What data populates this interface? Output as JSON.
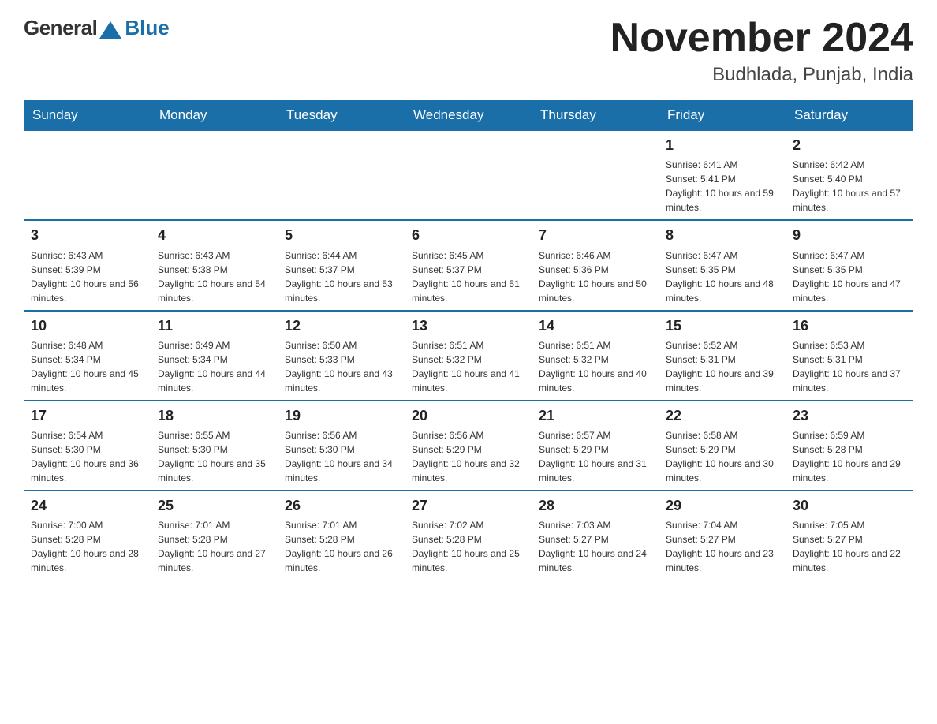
{
  "header": {
    "logo_general": "General",
    "logo_blue": "Blue",
    "month_title": "November 2024",
    "location": "Budhlada, Punjab, India"
  },
  "days_of_week": [
    "Sunday",
    "Monday",
    "Tuesday",
    "Wednesday",
    "Thursday",
    "Friday",
    "Saturday"
  ],
  "weeks": [
    [
      {
        "day": "",
        "info": ""
      },
      {
        "day": "",
        "info": ""
      },
      {
        "day": "",
        "info": ""
      },
      {
        "day": "",
        "info": ""
      },
      {
        "day": "",
        "info": ""
      },
      {
        "day": "1",
        "info": "Sunrise: 6:41 AM\nSunset: 5:41 PM\nDaylight: 10 hours and 59 minutes."
      },
      {
        "day": "2",
        "info": "Sunrise: 6:42 AM\nSunset: 5:40 PM\nDaylight: 10 hours and 57 minutes."
      }
    ],
    [
      {
        "day": "3",
        "info": "Sunrise: 6:43 AM\nSunset: 5:39 PM\nDaylight: 10 hours and 56 minutes."
      },
      {
        "day": "4",
        "info": "Sunrise: 6:43 AM\nSunset: 5:38 PM\nDaylight: 10 hours and 54 minutes."
      },
      {
        "day": "5",
        "info": "Sunrise: 6:44 AM\nSunset: 5:37 PM\nDaylight: 10 hours and 53 minutes."
      },
      {
        "day": "6",
        "info": "Sunrise: 6:45 AM\nSunset: 5:37 PM\nDaylight: 10 hours and 51 minutes."
      },
      {
        "day": "7",
        "info": "Sunrise: 6:46 AM\nSunset: 5:36 PM\nDaylight: 10 hours and 50 minutes."
      },
      {
        "day": "8",
        "info": "Sunrise: 6:47 AM\nSunset: 5:35 PM\nDaylight: 10 hours and 48 minutes."
      },
      {
        "day": "9",
        "info": "Sunrise: 6:47 AM\nSunset: 5:35 PM\nDaylight: 10 hours and 47 minutes."
      }
    ],
    [
      {
        "day": "10",
        "info": "Sunrise: 6:48 AM\nSunset: 5:34 PM\nDaylight: 10 hours and 45 minutes."
      },
      {
        "day": "11",
        "info": "Sunrise: 6:49 AM\nSunset: 5:34 PM\nDaylight: 10 hours and 44 minutes."
      },
      {
        "day": "12",
        "info": "Sunrise: 6:50 AM\nSunset: 5:33 PM\nDaylight: 10 hours and 43 minutes."
      },
      {
        "day": "13",
        "info": "Sunrise: 6:51 AM\nSunset: 5:32 PM\nDaylight: 10 hours and 41 minutes."
      },
      {
        "day": "14",
        "info": "Sunrise: 6:51 AM\nSunset: 5:32 PM\nDaylight: 10 hours and 40 minutes."
      },
      {
        "day": "15",
        "info": "Sunrise: 6:52 AM\nSunset: 5:31 PM\nDaylight: 10 hours and 39 minutes."
      },
      {
        "day": "16",
        "info": "Sunrise: 6:53 AM\nSunset: 5:31 PM\nDaylight: 10 hours and 37 minutes."
      }
    ],
    [
      {
        "day": "17",
        "info": "Sunrise: 6:54 AM\nSunset: 5:30 PM\nDaylight: 10 hours and 36 minutes."
      },
      {
        "day": "18",
        "info": "Sunrise: 6:55 AM\nSunset: 5:30 PM\nDaylight: 10 hours and 35 minutes."
      },
      {
        "day": "19",
        "info": "Sunrise: 6:56 AM\nSunset: 5:30 PM\nDaylight: 10 hours and 34 minutes."
      },
      {
        "day": "20",
        "info": "Sunrise: 6:56 AM\nSunset: 5:29 PM\nDaylight: 10 hours and 32 minutes."
      },
      {
        "day": "21",
        "info": "Sunrise: 6:57 AM\nSunset: 5:29 PM\nDaylight: 10 hours and 31 minutes."
      },
      {
        "day": "22",
        "info": "Sunrise: 6:58 AM\nSunset: 5:29 PM\nDaylight: 10 hours and 30 minutes."
      },
      {
        "day": "23",
        "info": "Sunrise: 6:59 AM\nSunset: 5:28 PM\nDaylight: 10 hours and 29 minutes."
      }
    ],
    [
      {
        "day": "24",
        "info": "Sunrise: 7:00 AM\nSunset: 5:28 PM\nDaylight: 10 hours and 28 minutes."
      },
      {
        "day": "25",
        "info": "Sunrise: 7:01 AM\nSunset: 5:28 PM\nDaylight: 10 hours and 27 minutes."
      },
      {
        "day": "26",
        "info": "Sunrise: 7:01 AM\nSunset: 5:28 PM\nDaylight: 10 hours and 26 minutes."
      },
      {
        "day": "27",
        "info": "Sunrise: 7:02 AM\nSunset: 5:28 PM\nDaylight: 10 hours and 25 minutes."
      },
      {
        "day": "28",
        "info": "Sunrise: 7:03 AM\nSunset: 5:27 PM\nDaylight: 10 hours and 24 minutes."
      },
      {
        "day": "29",
        "info": "Sunrise: 7:04 AM\nSunset: 5:27 PM\nDaylight: 10 hours and 23 minutes."
      },
      {
        "day": "30",
        "info": "Sunrise: 7:05 AM\nSunset: 5:27 PM\nDaylight: 10 hours and 22 minutes."
      }
    ]
  ]
}
